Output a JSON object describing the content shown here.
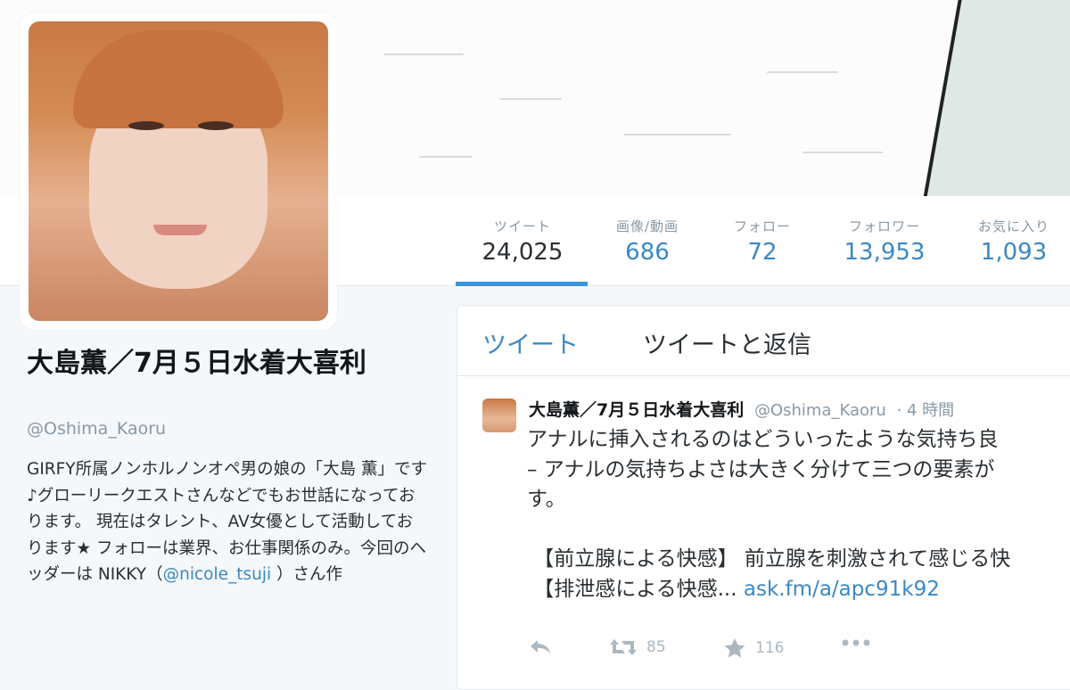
{
  "stats": [
    {
      "label": "ツイート",
      "value": "24,025"
    },
    {
      "label": "画像/動画",
      "value": "686"
    },
    {
      "label": "フォロー",
      "value": "72"
    },
    {
      "label": "フォロワー",
      "value": "13,953"
    },
    {
      "label": "お気に入り",
      "value": "1,093"
    }
  ],
  "profile": {
    "name": "大島薫／7月５日水着大喜利",
    "handle": "@Oshima_Kaoru",
    "bio_before_link": "GIRFY所属ノンホルノンオペ男の娘の「大島 薫」です♪グローリークエストさんなどでもお世話になっております。 現在はタレント、AV女優として活動しております★ フォローは業界、お仕事関係のみ。今回のヘッダーは\nNIKKY（",
    "bio_link": "@nicole_tsuji",
    "bio_after_link": " ）さん作"
  },
  "timeline": {
    "tab_tweets": "ツイート",
    "tab_replies": "ツイートと返信"
  },
  "tweet": {
    "name": "大島薫／7月５日水着大喜利",
    "handle": "@Oshima_Kaoru",
    "time": "· 4 時間",
    "body": "アナルに挿入されるのはどういったような気持ち良\n– アナルの気持ちよさは大きく分けて三つの要素が\nす。\n\n 【前立腺による快感】 前立腺を刺激されて感じる快\n 【排泄感による快感... ",
    "link": "ask.fm/a/apc91k92",
    "retweets": "85",
    "favorites": "116"
  },
  "colors": {
    "accent": "#3b88c3",
    "underline": "#3b94d9",
    "muted": "#8899a6"
  }
}
